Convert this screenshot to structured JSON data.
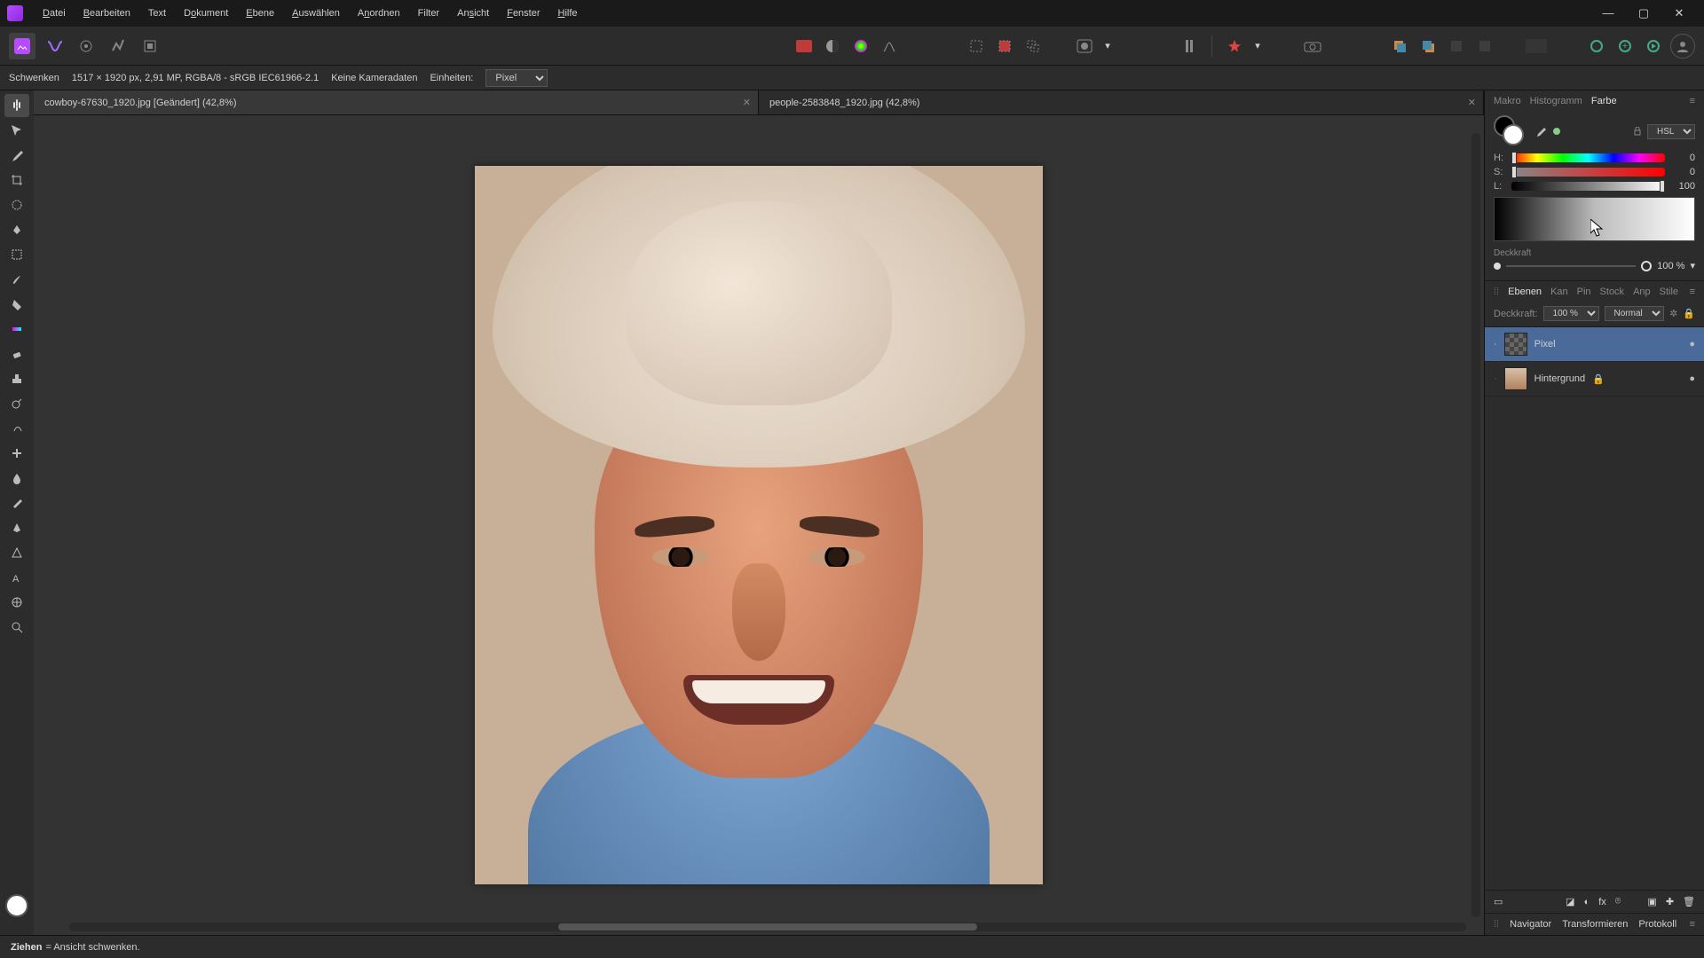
{
  "menubar": {
    "items": [
      "Datei",
      "Bearbeiten",
      "Text",
      "Dokument",
      "Ebene",
      "Auswählen",
      "Anordnen",
      "Filter",
      "Ansicht",
      "Fenster",
      "Hilfe"
    ]
  },
  "contextbar": {
    "tool_name": "Schwenken",
    "doc_info": "1517 × 1920 px, 2,91 MP, RGBA/8 - sRGB IEC61966-2.1",
    "camera": "Keine Kameradaten",
    "units_label": "Einheiten:",
    "units_value": "Pixel"
  },
  "tabs": [
    {
      "title": "cowboy-67630_1920.jpg [Geändert] (42,8%)"
    },
    {
      "title": "people-2583848_1920.jpg (42,8%)"
    }
  ],
  "right": {
    "top_tabs": [
      "Makro",
      "Histogramm",
      "Farbe"
    ],
    "color_model": "HSL",
    "hsl": {
      "h_label": "H:",
      "h_val": "0",
      "s_label": "S:",
      "s_val": "0",
      "l_label": "L:",
      "l_val": "100"
    },
    "opacity_label": "Deckkraft",
    "opacity_value": "100 %",
    "mid_tabs": [
      "Ebenen",
      "Kan",
      "Pin",
      "Stock",
      "Anp",
      "Stile"
    ],
    "layer_opacity_label": "Deckkraft:",
    "layer_opacity_value": "100 %",
    "blend_mode": "Normal",
    "layers": [
      {
        "name": "Pixel",
        "selected": true,
        "checker": true,
        "locked": false
      },
      {
        "name": "Hintergrund",
        "selected": false,
        "checker": false,
        "locked": true
      }
    ],
    "bottom_tabs": [
      "Navigator",
      "Transformieren",
      "Protokoll"
    ]
  },
  "statusbar": {
    "action": "Ziehen",
    "desc": " = Ansicht schwenken."
  }
}
